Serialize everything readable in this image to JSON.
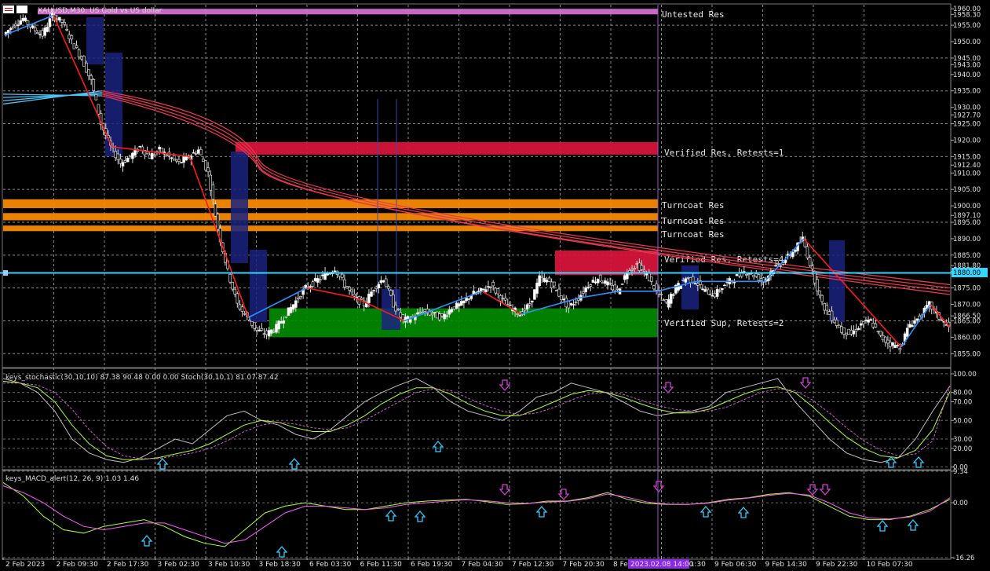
{
  "window": {
    "title": "XAUUSD,M30: US Gold vs US dollar",
    "window_icon": "chart-window-icon",
    "colors": {
      "background": "#000000",
      "grid": "#9a9a9a",
      "bull_candle": "#ffffff",
      "bear_candle": "#ffffff"
    }
  },
  "chart_data": [
    {
      "type": "candlestick",
      "symbol": "XAUUSD",
      "timeframe": "M30",
      "title": "XAUUSD,M30: US Gold vs US dollar",
      "ylim": [
        1851,
        1961
      ],
      "price_ticks": [
        "1960.00",
        "1958.30",
        "1955.00",
        "1950.00",
        "1945.00",
        "1943.00",
        "1940.00",
        "1935.00",
        "1930.00",
        "1927.70",
        "1925.00",
        "1920.00",
        "1915.00",
        "1912.40",
        "1910.00",
        "1905.00",
        "1900.00",
        "1897.10",
        "1895.00",
        "1890.00",
        "1885.00",
        "1881.80",
        "1880.00",
        "1875.00",
        "1870.00",
        "1866.50",
        "1865.00",
        "1860.00",
        "1855.00"
      ],
      "x_ticks": [
        "2 Feb 2023",
        "2 Feb 09:30",
        "2 Feb 17:30",
        "3 Feb 02:30",
        "3 Feb 10:30",
        "3 Feb 18:30",
        "6 Feb 03:30",
        "6 Feb 11:30",
        "6 Feb 19:30",
        "7 Feb 04:30",
        "7 Feb 12:30",
        "7 Feb 20:30",
        "8 Feb",
        "8 Feb 21:30",
        "9 Feb 06:30",
        "9 Feb 14:30",
        "9 Feb 22:30",
        "10 Feb 07:30"
      ],
      "crosshair": {
        "time_label": "2023.02.08 14:00",
        "price": "1880.00"
      },
      "zones": [
        {
          "label": "Untested Res",
          "kind": "untested_res",
          "color": "#da70d6",
          "low": 1958.3,
          "high": 1960.0
        },
        {
          "label": "Verified Res, Retests=1",
          "kind": "verified_res",
          "color": "#dc143c",
          "low": 1915.6,
          "high": 1919.4
        },
        {
          "label": "Turncoat Res",
          "kind": "turncoat",
          "color": "#ff8c00",
          "low": 1899.3,
          "high": 1902.0
        },
        {
          "label": "Turncoat Res",
          "kind": "turncoat",
          "color": "#ff8c00",
          "low": 1895.6,
          "high": 1897.8
        },
        {
          "label": "Turncoat Res",
          "kind": "turncoat",
          "color": "#ff8c00",
          "low": 1892.3,
          "high": 1894.0
        },
        {
          "label": "Verified Res, Retests=4",
          "kind": "verified_res",
          "color": "#dc143c",
          "low": 1878.9,
          "high": 1886.4
        },
        {
          "label": "Verified Sup, Retests=2",
          "kind": "verified_sup",
          "color": "#008a00",
          "low": 1860.0,
          "high": 1868.8
        }
      ],
      "close_path": [
        1952,
        1955,
        1957,
        1954,
        1952,
        1958,
        1956,
        1950,
        1945,
        1938,
        1925,
        1918,
        1913,
        1915,
        1918,
        1915,
        1917,
        1915,
        1913,
        1915,
        1917,
        1910,
        1893,
        1880,
        1870,
        1866,
        1862,
        1861,
        1863,
        1867,
        1871,
        1875,
        1877,
        1879,
        1881,
        1876,
        1872,
        1870,
        1875,
        1878,
        1870,
        1865,
        1866,
        1868,
        1867,
        1866,
        1869,
        1870,
        1873,
        1874,
        1876,
        1872,
        1869,
        1867,
        1870,
        1878,
        1877,
        1873,
        1869,
        1872,
        1876,
        1878,
        1876,
        1874,
        1880,
        1882,
        1879,
        1874,
        1870,
        1875,
        1878,
        1877,
        1874,
        1873,
        1876,
        1878,
        1880,
        1879,
        1877,
        1881,
        1883,
        1886,
        1890,
        1880,
        1870,
        1866,
        1862,
        1861,
        1864,
        1865,
        1860,
        1858,
        1857,
        1864,
        1866,
        1870,
        1866,
        1863
      ],
      "ribbon_start": [
        1931,
        1932,
        1933,
        1934
      ],
      "ribbon_bend": [
        1935,
        1934.5,
        1934,
        1933.5
      ],
      "ribbon_mid": [
        1914,
        1913,
        1912,
        1911.5
      ],
      "ribbon_end": [
        1876,
        1875,
        1874,
        1873
      ]
    },
    {
      "type": "line",
      "title": "keys_stochastic(30,10,10) 87.38 90.48 0.00 0.00 Stoch(30,10,1) 81.07 87.42",
      "indicator": "keys_stochastic",
      "ylim": [
        -2,
        105
      ],
      "y_ticks": [
        "100.00",
        "80.00",
        "70.00",
        "50.00",
        "30.00",
        "20.00",
        "0.00"
      ],
      "series": [
        {
          "name": "Stoch(30,10,1)",
          "color": "#c0c0c0",
          "values": [
            95,
            90,
            80,
            60,
            30,
            15,
            8,
            5,
            10,
            20,
            30,
            25,
            40,
            55,
            60,
            50,
            45,
            35,
            30,
            40,
            55,
            70,
            80,
            88,
            95,
            85,
            70,
            60,
            55,
            50,
            60,
            75,
            80,
            90,
            85,
            80,
            70,
            60,
            55,
            58,
            60,
            65,
            80,
            85,
            90,
            95,
            70,
            50,
            30,
            15,
            8,
            5,
            10,
            30,
            60,
            87
          ]
        },
        {
          "name": "",
          "color": "#adff2f",
          "values": [
            92,
            90,
            85,
            70,
            45,
            25,
            12,
            8,
            8,
            10,
            14,
            18,
            25,
            35,
            45,
            50,
            48,
            42,
            38,
            38,
            45,
            55,
            68,
            78,
            85,
            85,
            78,
            68,
            60,
            55,
            55,
            62,
            70,
            78,
            82,
            80,
            75,
            68,
            62,
            58,
            58,
            62,
            70,
            78,
            84,
            86,
            80,
            65,
            48,
            32,
            20,
            12,
            10,
            18,
            40,
            81
          ]
        },
        {
          "name": "",
          "color": "#d05cd0",
          "values": [
            90,
            90,
            88,
            80,
            62,
            40,
            22,
            12,
            9,
            9,
            12,
            15,
            20,
            28,
            38,
            45,
            48,
            46,
            42,
            40,
            42,
            50,
            60,
            70,
            80,
            84,
            82,
            74,
            66,
            60,
            56,
            58,
            64,
            72,
            78,
            80,
            78,
            72,
            66,
            62,
            60,
            60,
            64,
            72,
            80,
            84,
            82,
            72,
            58,
            42,
            28,
            18,
            12,
            14,
            28,
            87
          ]
        }
      ],
      "up_signals": [
        3,
        5,
        9,
        20,
        21
      ],
      "down_signals": [
        10,
        14,
        16,
        17
      ]
    },
    {
      "type": "line",
      "title": "keys_MACD_alert(12, 26, 9) 1.03 1.46",
      "indicator": "keys_MACD_alert",
      "ylim": [
        -16.26,
        9.34
      ],
      "y_ticks": [
        "9.34",
        "0.00",
        "-16.26"
      ],
      "series": [
        {
          "name": "",
          "color": "#adff2f",
          "values": [
            6,
            2,
            -4,
            -8,
            -9,
            -7,
            -6,
            -5,
            -7,
            -10,
            -12,
            -13,
            -8,
            -3,
            -1,
            0,
            -1,
            -2,
            -2,
            -1,
            0,
            0.5,
            0.8,
            1,
            0.3,
            -0.5,
            -0.3,
            0.5,
            0.5,
            1.5,
            3,
            1,
            -0.2,
            -0.5,
            -0.5,
            0,
            1,
            1.5,
            2.5,
            3,
            2,
            -1,
            -4,
            -5,
            -5,
            -4,
            -2,
            1
          ]
        },
        {
          "name": "",
          "color": "#ff5cff",
          "values": [
            5,
            3,
            0,
            -4,
            -7,
            -8,
            -7,
            -6,
            -6,
            -8,
            -10,
            -12,
            -11,
            -7,
            -3,
            -1,
            -1,
            -1.5,
            -2,
            -1.5,
            -0.5,
            0,
            0.5,
            0.9,
            0.6,
            0,
            -0.2,
            0.2,
            0.4,
            1.2,
            2.6,
            1.6,
            0.2,
            -0.4,
            -0.5,
            -0.1,
            0.8,
            1.4,
            2.2,
            2.8,
            2.3,
            0,
            -3,
            -4.5,
            -4.8,
            -4.2,
            -2.5,
            1.5
          ]
        }
      ],
      "up_signals": [
        0,
        1,
        2,
        3,
        4,
        5,
        6,
        7
      ],
      "down_signals": [
        0,
        1,
        2,
        3,
        4
      ]
    }
  ]
}
